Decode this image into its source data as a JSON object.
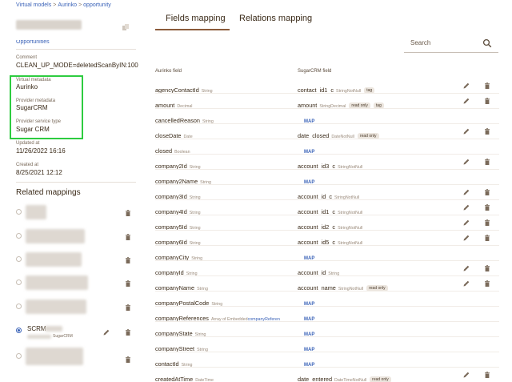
{
  "breadcrumb": [
    "Virtual models",
    "Aurinko",
    "opportunity"
  ],
  "left": {
    "description_link": "Opportunities",
    "fields": [
      {
        "label": "Comment",
        "value": "CLEAN_UP_MODE=deletedScanByIN:100"
      },
      {
        "label": "Virtual metadata",
        "value": "Aurinko"
      },
      {
        "label": "Provider metadata",
        "value": "SugarCRM"
      },
      {
        "label": "Provider service type",
        "value": "Sugar CRM"
      },
      {
        "label": "Updated at",
        "value": "11/26/2022 16:16"
      },
      {
        "label": "Created at",
        "value": "8/25/2021 12:12"
      }
    ],
    "related_title": "Related mappings",
    "selected_mapping": {
      "label": "SCRM",
      "sub": "SugarCRM"
    }
  },
  "tabs": [
    "Fields mapping",
    "Relations mapping"
  ],
  "search": {
    "placeholder": "Search"
  },
  "columns": {
    "source": "Aurinko field",
    "target": "SugarCRM field"
  },
  "map_label": "MAP",
  "rows": [
    {
      "name": "agencyContactId",
      "type": "String",
      "target": "contact_id1_c",
      "ttype": "StringNotNull",
      "badges": [
        "tag"
      ]
    },
    {
      "name": "amount",
      "type": "Decimal",
      "target": "amount",
      "ttype": "StringDecimal",
      "badges": [
        "read only",
        "tag"
      ]
    },
    {
      "name": "cancelledReason",
      "type": "String",
      "target": "",
      "ttype": "",
      "badges": []
    },
    {
      "name": "closeDate",
      "type": "Date",
      "target": "date_closed",
      "ttype": "DateNotNull",
      "badges": [
        "read only"
      ]
    },
    {
      "name": "closed",
      "type": "Boolean",
      "target": "",
      "ttype": "",
      "badges": []
    },
    {
      "name": "company2Id",
      "type": "String",
      "target": "account_id3_c",
      "ttype": "StringNotNull",
      "badges": []
    },
    {
      "name": "company2Name",
      "type": "String",
      "target": "",
      "ttype": "",
      "badges": []
    },
    {
      "name": "company3Id",
      "type": "String",
      "target": "account_id_c",
      "ttype": "StringNotNull",
      "badges": []
    },
    {
      "name": "company4Id",
      "type": "String",
      "target": "account_id1_c",
      "ttype": "StringNotNull",
      "badges": []
    },
    {
      "name": "company5Id",
      "type": "String",
      "target": "account_id2_c",
      "ttype": "StringNotNull",
      "badges": []
    },
    {
      "name": "company6Id",
      "type": "String",
      "target": "account_id5_c",
      "ttype": "StringNotNull",
      "badges": []
    },
    {
      "name": "companyCity",
      "type": "String",
      "target": "",
      "ttype": "",
      "badges": []
    },
    {
      "name": "companyId",
      "type": "String",
      "target": "account_id",
      "ttype": "String",
      "badges": []
    },
    {
      "name": "companyName",
      "type": "String",
      "target": "account_name",
      "ttype": "StringNotNull",
      "badges": [
        "read only"
      ]
    },
    {
      "name": "companyPostalCode",
      "type": "String",
      "target": "",
      "ttype": "",
      "badges": []
    },
    {
      "name": "companyReferences",
      "type": "Array of Embedded",
      "typelink": "companyReferen",
      "target": "",
      "ttype": "",
      "badges": []
    },
    {
      "name": "companyState",
      "type": "String",
      "target": "",
      "ttype": "",
      "badges": []
    },
    {
      "name": "companyStreet",
      "type": "String",
      "target": "",
      "ttype": "",
      "badges": []
    },
    {
      "name": "contactId",
      "type": "String",
      "target": "",
      "ttype": "",
      "badges": []
    },
    {
      "name": "createdAtTime",
      "type": "DateTime",
      "target": "date_entered",
      "ttype": "DateTimeNotNull",
      "badges": [
        "read only"
      ]
    }
  ],
  "colors": {
    "link": "#3b63b8",
    "highlight": "#2ecc40",
    "text": "#3a2a18"
  }
}
